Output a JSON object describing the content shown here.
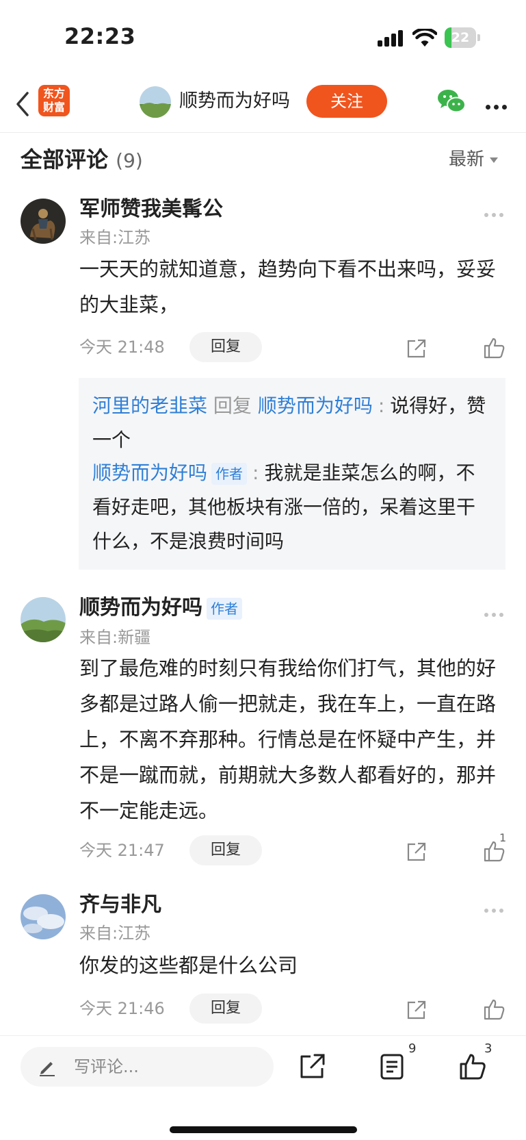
{
  "status_bar": {
    "time": "22:23",
    "battery_level": "22",
    "battery_fraction": 0.22
  },
  "nav": {
    "logo_line1": "东方",
    "logo_line2": "财富",
    "name": "顺势而为好吗",
    "follow_label": "关注"
  },
  "section": {
    "title": "全部评论",
    "count": "(9)",
    "sort_label": "最新"
  },
  "comments": [
    {
      "name": "军师赞我美髯公",
      "location": "来自:江苏",
      "text": "一天天的就知道意，趋势向下看不出来吗，妥妥的大韭菜，",
      "time": "今天 21:48",
      "reply_label": "回复",
      "replies": [
        {
          "from": "河里的老韭菜",
          "verb": "回复",
          "to": "顺势而为好吗",
          "colon": ":",
          "text": "说得好，赞一个"
        },
        {
          "from": "顺势而为好吗",
          "tag": "作者",
          "colon": ":",
          "text": "我就是韭菜怎么的啊，不看好走吧，其他板块有涨一倍的，呆着这里干什么，不是浪费时间吗"
        }
      ]
    },
    {
      "name": "顺势而为好吗",
      "tag": "作者",
      "location": "来自:新疆",
      "text": "到了最危难的时刻只有我给你们打气，其他的好多都是过路人偷一把就走，我在车上，一直在路上，不离不弃那种。行情总是在怀疑中产生，并不是一蹴而就，前期就大多数人都看好的，那并不一定能走远。",
      "time": "今天 21:47",
      "reply_label": "回复",
      "like_count": "1"
    },
    {
      "name": "齐与非凡",
      "location": "来自:江苏",
      "text": "你发的这些都是什么公司",
      "time": "今天 21:46",
      "reply_label": "回复"
    }
  ],
  "bottom_bar": {
    "placeholder": "写评论...",
    "comment_count": "9",
    "like_count": "3"
  }
}
